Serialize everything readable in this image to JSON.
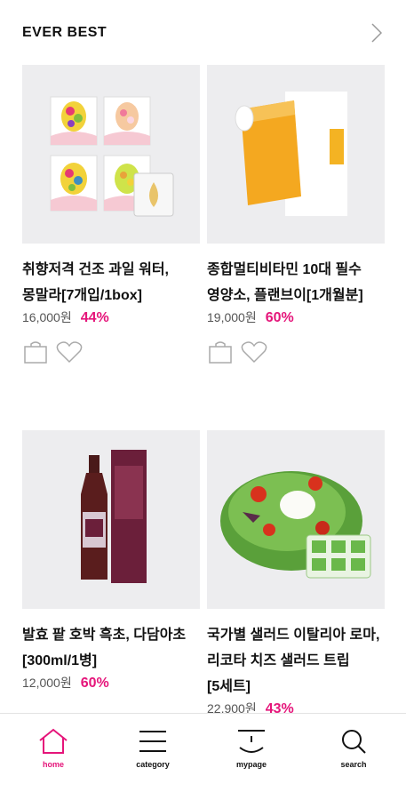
{
  "header": {
    "title": "EVER BEST"
  },
  "products": [
    {
      "name": "취향저격 건조 과일 워터, 몽말라[7개입/1box]",
      "price": "16,000원",
      "discount": "44%"
    },
    {
      "name": "종합멀티비타민 10대 필수 영양소, 플랜브이[1개월분]",
      "price": "19,000원",
      "discount": "60%"
    },
    {
      "name": "발효 팥 호박 흑초, 다담아초[300ml/1병]",
      "price": "12,000원",
      "discount": "60%"
    },
    {
      "name": "국가별 샐러드 이탈리아 로마, 리코타 치즈 샐러드 트립[5세트]",
      "price": "22,900원",
      "discount": "43%"
    }
  ],
  "tabbar": {
    "tabs": [
      {
        "label": "home",
        "icon": "home-icon",
        "active": true
      },
      {
        "label": "category",
        "icon": "menu-icon",
        "active": false
      },
      {
        "label": "mypage",
        "icon": "user-face-icon",
        "active": false
      },
      {
        "label": "search",
        "icon": "search-icon",
        "active": false
      }
    ]
  },
  "colors": {
    "accent": "#e5157a",
    "thumb_bg": "#ededef"
  }
}
